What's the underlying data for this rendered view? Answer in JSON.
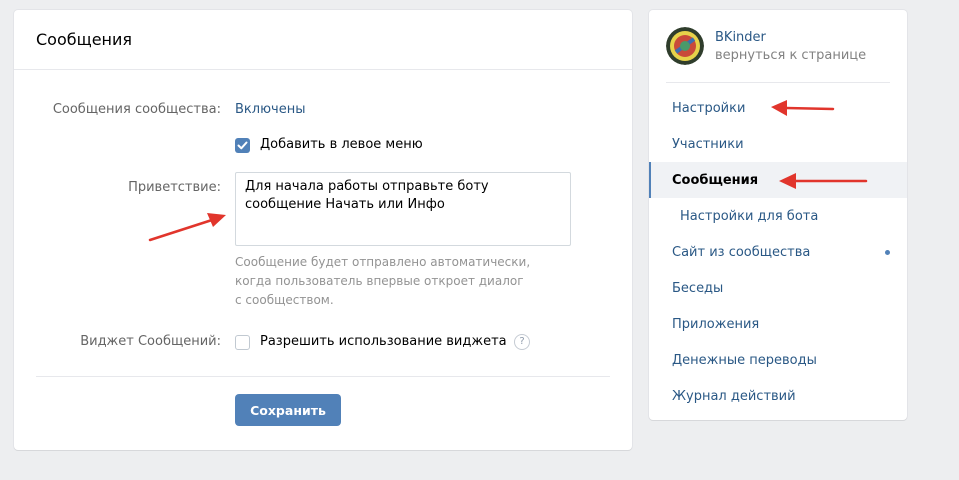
{
  "main": {
    "title": "Сообщения",
    "messages_label": "Сообщения сообщества:",
    "messages_value": "Включены",
    "add_menu_label": "Добавить в левое меню",
    "add_menu_checked": true,
    "greeting_label": "Приветствие:",
    "greeting_value": "Для начала работы отправьте боту сообщение Начать или Инфо",
    "hint_line1": "Сообщение будет отправлено автоматически,",
    "hint_line2": "когда пользователь впервые откроет диалог",
    "hint_line3": "с сообществом.",
    "widget_label": "Виджет Сообщений:",
    "widget_option": "Разрешить использование виджета",
    "widget_checked": false,
    "help_glyph": "?",
    "save_button": "Сохранить"
  },
  "sidebar": {
    "profile_name": "BKinder",
    "profile_back": "вернуться к странице",
    "items": [
      {
        "label": "Настройки"
      },
      {
        "label": "Участники"
      },
      {
        "label": "Сообщения",
        "active": true
      },
      {
        "label": "Настройки для бота",
        "sub": true
      },
      {
        "label": "Сайт из сообщества",
        "indicator": true
      },
      {
        "label": "Беседы"
      },
      {
        "label": "Приложения"
      },
      {
        "label": "Денежные переводы"
      },
      {
        "label": "Журнал действий"
      }
    ]
  },
  "colors": {
    "accent": "#5181b8",
    "link": "#2a5885",
    "annotation_arrow": "#e1352c",
    "background": "#edeef0"
  },
  "icons": [
    "checkbox-checked-icon",
    "checkbox-empty-icon",
    "help-icon",
    "avatar-icon",
    "red-annotation-arrow-icon"
  ]
}
